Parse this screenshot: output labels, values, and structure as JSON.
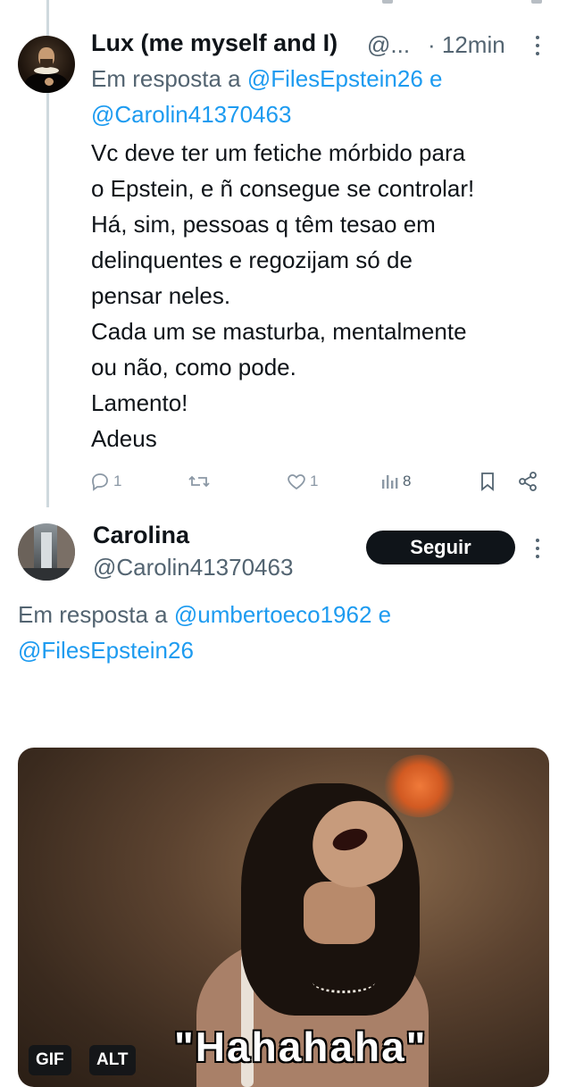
{
  "tweet1": {
    "author_name": "Lux (me myself and I)",
    "handle_truncated": "@...",
    "time": "· 12min",
    "reply_prefix": "Em resposta a",
    "reply_mention_1": "@FilesEpstein26",
    "reply_and": "e",
    "reply_mention_2": "@Carolin41370463",
    "text_lines": [
      "Vc deve ter um fetiche mórbido para",
      "o Epstein, e ñ consegue se controlar!",
      "Há, sim, pessoas q têm tesao em",
      "delinquentes e regozijam só de",
      "pensar neles.",
      "Cada um se masturba, mentalmente",
      "ou não, como pode.",
      "Lamento!",
      "Adeus"
    ],
    "actions": {
      "reply_count": "1",
      "repost_count": "",
      "like_count": "1",
      "views_count": "8"
    }
  },
  "tweet2": {
    "author_name": "Carolina",
    "handle": "@Carolin41370463",
    "follow_label": "Seguir",
    "reply_prefix": "Em resposta a",
    "reply_mention_1": "@umbertoeco1962",
    "reply_and": "e",
    "reply_mention_2": "@FilesEpstein26",
    "media": {
      "caption": "\"Hahahaha\"",
      "gif_badge": "GIF",
      "alt_badge": "ALT"
    }
  },
  "colors": {
    "text": "#0f1419",
    "secondary": "#536471",
    "link": "#1d9bf0",
    "icon": "#8b98a5",
    "button_bg": "#0f1419"
  }
}
